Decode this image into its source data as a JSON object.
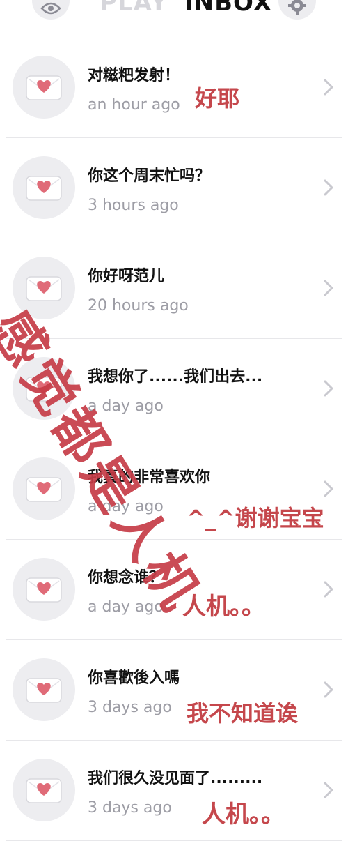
{
  "header": {
    "left_icon": "eye-icon",
    "tabs": [
      {
        "label": "PLAY",
        "active": false
      },
      {
        "label": "INBOX",
        "active": true
      }
    ],
    "right_icon": "gear-icon"
  },
  "messages": [
    {
      "title": "对糍粑发射！",
      "time": "an hour ago"
    },
    {
      "title": "你这个周末忙吗？",
      "time": "3 hours ago"
    },
    {
      "title": "你好呀范儿",
      "time": "20 hours ago"
    },
    {
      "title": "我想你了......我们出去...",
      "time": "a day ago"
    },
    {
      "title": "我真的非常喜欢你",
      "time": "a day ago"
    },
    {
      "title": "你想念谁？",
      "time": "a day ago"
    },
    {
      "title": "你喜歡後入嗎",
      "time": "3 days ago"
    },
    {
      "title": "我们很久没见面了.........",
      "time": "3 days ago"
    }
  ],
  "annotations": {
    "row1": "好耶",
    "row5": "^_^谢谢宝宝",
    "row6": "人机。。",
    "row7": "我不知道诶",
    "row8": "人机。。",
    "overlay": "感觉都是人机"
  },
  "colors": {
    "accent": "#c5474c",
    "heart": "#e06b78",
    "muted": "#9d9da5"
  }
}
